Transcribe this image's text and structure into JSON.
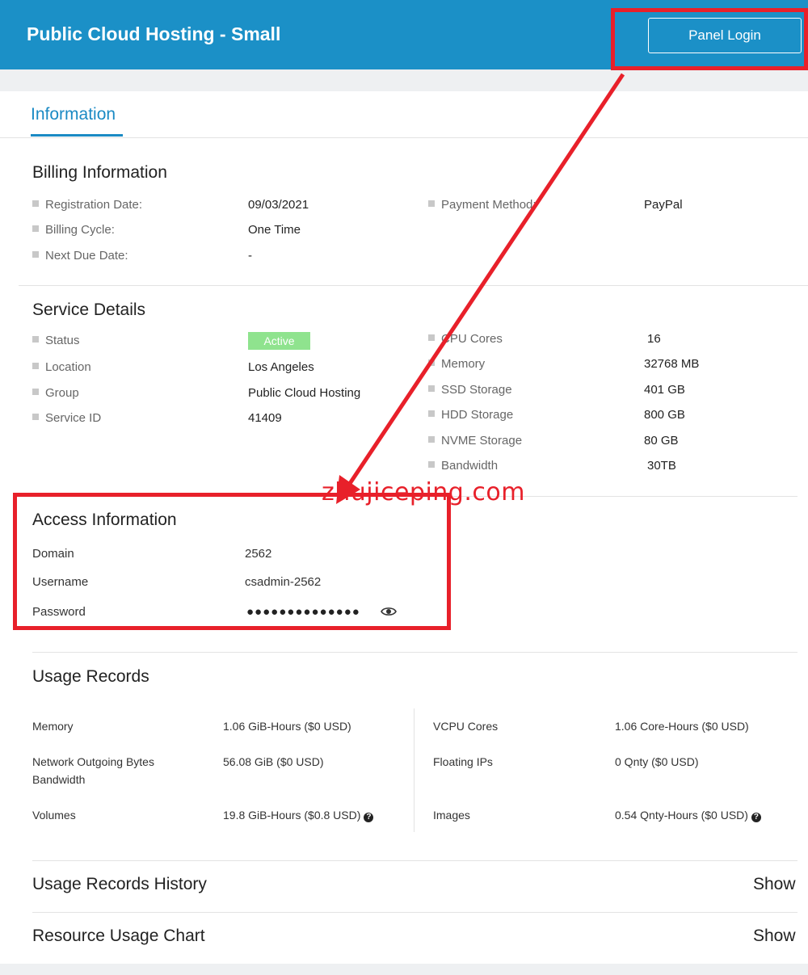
{
  "header": {
    "title": "Public Cloud Hosting - Small",
    "panel_login": "Panel Login"
  },
  "tabs": {
    "information": "Information"
  },
  "billing": {
    "heading": "Billing Information",
    "registration_label": "Registration Date:",
    "registration_value": "09/03/2021",
    "cycle_label": "Billing Cycle:",
    "cycle_value": "One Time",
    "due_label": "Next Due Date:",
    "due_value": "-",
    "payment_label": "Payment Method:",
    "payment_value": "PayPal"
  },
  "service": {
    "heading": "Service Details",
    "status_label": "Status",
    "status_value": "Active",
    "location_label": "Location",
    "location_value": "Los Angeles",
    "group_label": "Group",
    "group_value": "Public Cloud Hosting",
    "id_label": "Service ID",
    "id_value": "41409",
    "cpu_label": "CPU Cores",
    "cpu_value": "16",
    "memory_label": "Memory",
    "memory_value": "32768 MB",
    "ssd_label": "SSD Storage",
    "ssd_value": "401 GB",
    "hdd_label": "HDD Storage",
    "hdd_value": "800 GB",
    "nvme_label": "NVME Storage",
    "nvme_value": "80 GB",
    "bandwidth_label": "Bandwidth",
    "bandwidth_value": "30TB"
  },
  "access": {
    "heading": "Access Information",
    "domain_label": "Domain",
    "domain_value": "2562",
    "username_label": "Username",
    "username_value": "csadmin-2562",
    "password_label": "Password",
    "password_value": "●●●●●●●●●●●●●●"
  },
  "usage": {
    "heading": "Usage Records",
    "memory_label": "Memory",
    "memory_value": "1.06 GiB-Hours ($0 USD)",
    "network_label_1": "Network Outgoing Bytes",
    "network_label_2": "Bandwidth",
    "network_value": "56.08 GiB ($0 USD)",
    "volumes_label": "Volumes",
    "volumes_value": "19.8 GiB-Hours ($0.8 USD)",
    "vcpu_label": "VCPU Cores",
    "vcpu_value": "1.06 Core-Hours ($0 USD)",
    "floating_label": "Floating IPs",
    "floating_value": "0 Qnty ($0 USD)",
    "images_label": "Images",
    "images_value": "0.54 Qnty-Hours ($0 USD)"
  },
  "history": {
    "heading": "Usage Records History",
    "show": "Show"
  },
  "chart": {
    "heading": "Resource Usage Chart",
    "show": "Show"
  },
  "watermark": "zhujiceping.com",
  "colors": {
    "header": "#1b90c7",
    "accent": "#1b8ac4",
    "active_badge": "#8fe38e",
    "annotation": "#e8202a"
  },
  "icons": {
    "password_toggle": "eye-icon",
    "help": "question-circle-icon"
  }
}
